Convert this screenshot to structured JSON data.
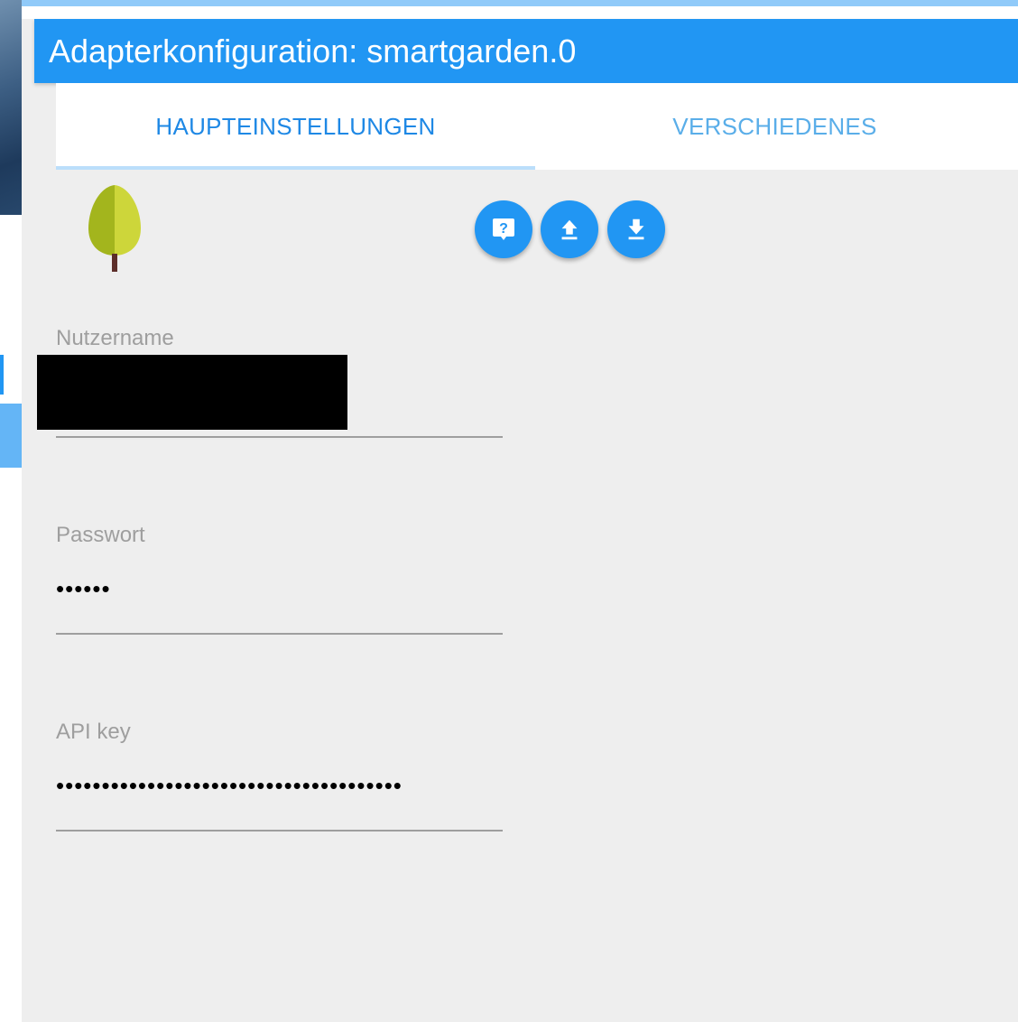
{
  "dialog": {
    "title": "Adapterkonfiguration: smartgarden.0"
  },
  "tabs": [
    {
      "label": "HAUPTEINSTELLUNGEN",
      "active": true
    },
    {
      "label": "VERSCHIEDENES",
      "active": false
    }
  ],
  "logo": {
    "icon": "tree-logo-icon",
    "colors": {
      "leaf_dark": "#a3b51d",
      "leaf_light": "#cdd63a",
      "trunk": "#5d2e2a"
    }
  },
  "toolbar": {
    "buttons": [
      {
        "icon": "help-icon"
      },
      {
        "icon": "upload-icon"
      },
      {
        "icon": "download-icon"
      }
    ]
  },
  "fields": {
    "username": {
      "label": "Nutzername",
      "value": ""
    },
    "password": {
      "label": "Passwort",
      "value": "••••••"
    },
    "api_key": {
      "label": "API key",
      "value": "••••••••••••••••••••••••••••••••••••••"
    }
  },
  "colors": {
    "primary": "#2196f3",
    "tab_active": "#1e88e5",
    "tab_inactive": "#5aaee9",
    "background": "#eeeeee",
    "label": "#9e9e9e"
  }
}
